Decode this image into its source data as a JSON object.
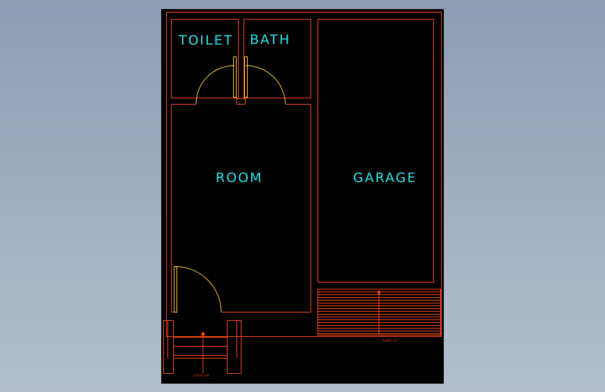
{
  "colors": {
    "background_top": "#8d9db5",
    "background_bottom": "#b4bfcd",
    "canvas": "#000000",
    "wall": "#ff4a1c",
    "door": "#ffd23a",
    "label": "#2fe6f0",
    "stair_arrow": "#ff4a1c"
  },
  "labels": {
    "toilet": "TOILET",
    "bath": "BATH",
    "room": "ROOM",
    "garage": "GARAGE",
    "stair_up": "STAIR UP",
    "ramp_up": "RAMP UP"
  }
}
